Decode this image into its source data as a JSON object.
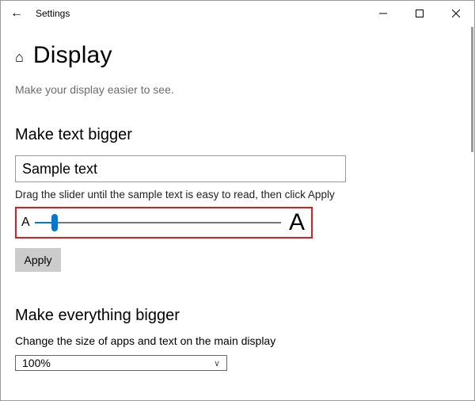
{
  "window": {
    "title": "Settings"
  },
  "page": {
    "heading": "Display",
    "subtitle": "Make your display easier to see."
  },
  "text_bigger": {
    "heading": "Make text bigger",
    "sample": "Sample text",
    "instruction": "Drag the slider until the sample text is easy to read, then click Apply",
    "small_letter": "A",
    "big_letter": "A",
    "apply_label": "Apply"
  },
  "everything_bigger": {
    "heading": "Make everything bigger",
    "desc": "Change the size of apps and text on the main display",
    "combo_value": "100%"
  }
}
